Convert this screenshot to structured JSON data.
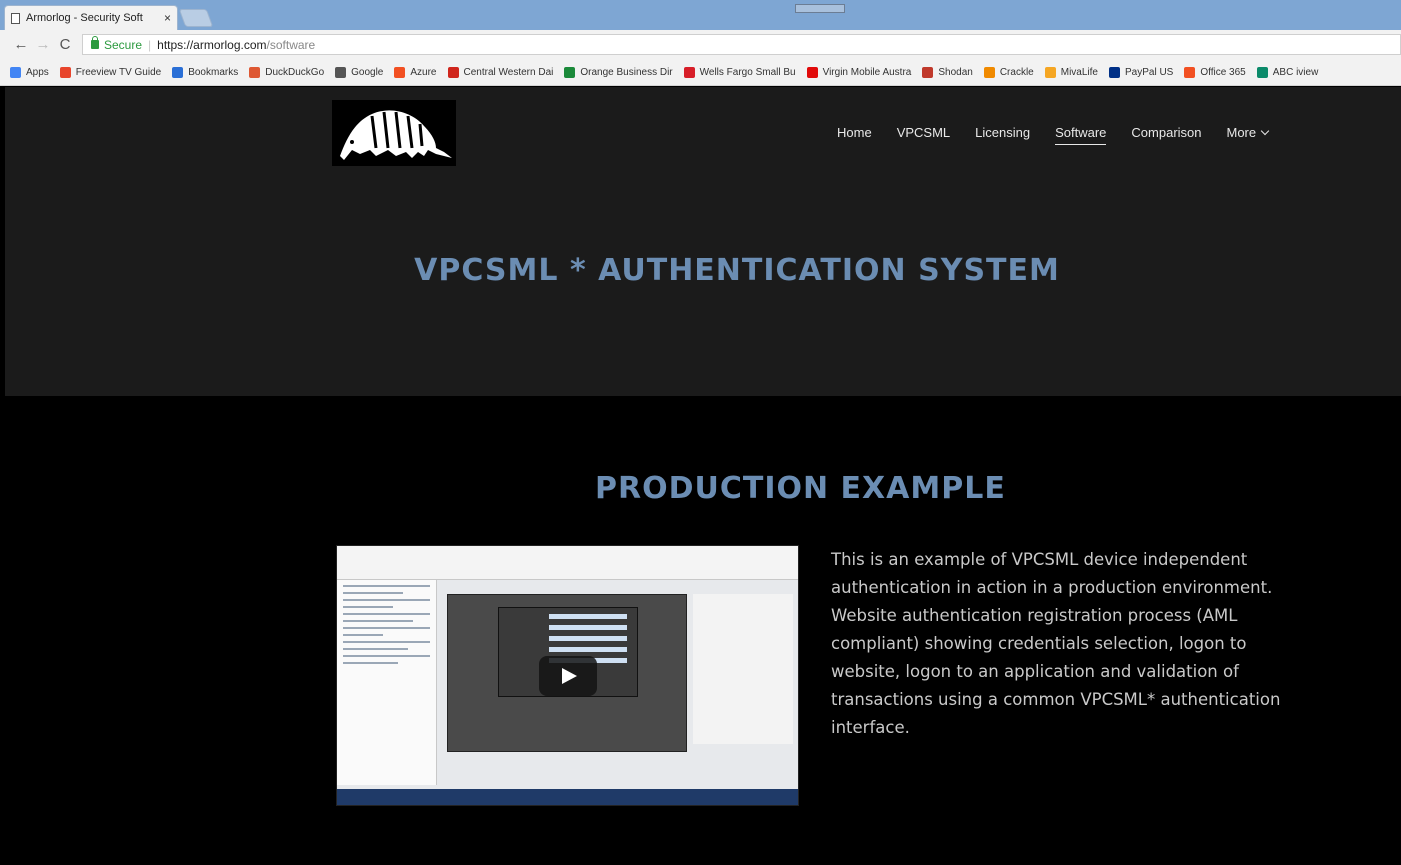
{
  "browser": {
    "tab_title": "Armorlog - Security Soft",
    "tab_close": "×",
    "nav": {
      "back": "←",
      "forward": "→",
      "reload": "C"
    },
    "address": {
      "secure_label": "Secure",
      "url_host": "https://armorlog.com",
      "url_path": "/software"
    },
    "bookmarks": [
      {
        "label": "Apps",
        "icon": "apps-grid-icon",
        "color": "#4285f4"
      },
      {
        "label": "Freeview TV Guide",
        "icon": "freeview-icon",
        "color": "#e8452c"
      },
      {
        "label": "Bookmarks",
        "icon": "star-icon",
        "color": "#2a6fd6"
      },
      {
        "label": "DuckDuckGo",
        "icon": "duckduckgo-icon",
        "color": "#de5833"
      },
      {
        "label": "Google",
        "icon": "google-icon",
        "color": "#555555"
      },
      {
        "label": "Azure",
        "icon": "windows-logo-icon",
        "color": "#f25022"
      },
      {
        "label": "Central Western Dai",
        "icon": "cw-icon",
        "color": "#d0261c"
      },
      {
        "label": "Orange Business Dir",
        "icon": "orange-biz-icon",
        "color": "#1b8a3a"
      },
      {
        "label": "Wells Fargo Small Bu",
        "icon": "wells-fargo-icon",
        "color": "#d71e28"
      },
      {
        "label": "Virgin Mobile Austra",
        "icon": "virgin-icon",
        "color": "#e10a0a"
      },
      {
        "label": "Shodan",
        "icon": "shodan-icon",
        "color": "#c0392b"
      },
      {
        "label": "Crackle",
        "icon": "crackle-icon",
        "color": "#f08a00"
      },
      {
        "label": "MivaLife",
        "icon": "mivalife-icon",
        "color": "#f5a623"
      },
      {
        "label": "PayPal US",
        "icon": "paypal-icon",
        "color": "#003087"
      },
      {
        "label": "Office 365",
        "icon": "office-icon",
        "color": "#f25022"
      },
      {
        "label": "ABC iview",
        "icon": "abc-icon",
        "color": "#0b8a6a"
      }
    ]
  },
  "site": {
    "logo_alt": "armadillo-logo",
    "nav": [
      "Home",
      "VPCSML",
      "Licensing",
      "Software",
      "Comparison",
      "More"
    ],
    "active_nav": "Software",
    "hero_title": "VPCSML * AUTHENTICATION SYSTEM",
    "section_title": "PRODUCTION EXAMPLE",
    "description": "This is an example of VPCSML device independent authentication in action in a production environment. Website authentication registration process (AML compliant) showing credentials selection, logon to website, logon to an application and validation of transactions using a common VPCSML* authentication interface.",
    "colors": {
      "heading": "#6b8db3",
      "hero_bg": "#1b1b1b",
      "section_bg": "#000000",
      "body_text": "#c9c9c9"
    }
  }
}
